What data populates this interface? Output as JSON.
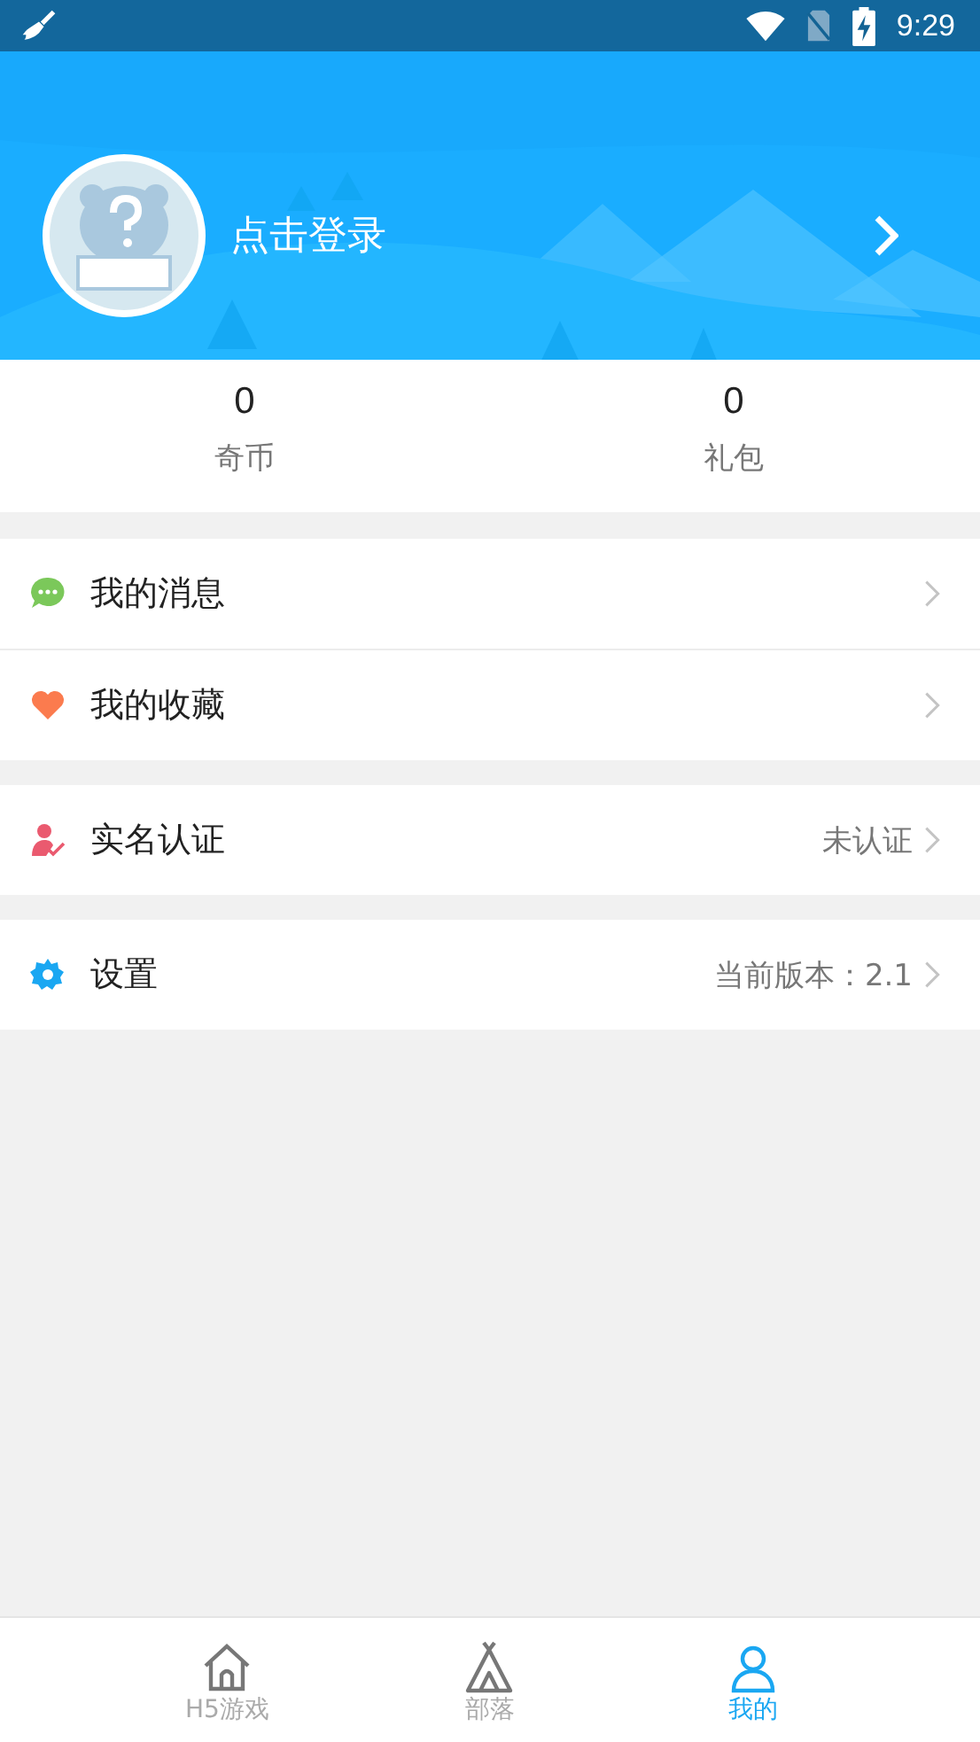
{
  "status_bar": {
    "time": "9:29"
  },
  "profile": {
    "login_label": "点击登录"
  },
  "stats": [
    {
      "value": "0",
      "label": "奇币"
    },
    {
      "value": "0",
      "label": "礼包"
    }
  ],
  "menu_groups": [
    {
      "items": [
        {
          "kind": "message",
          "label": "我的消息"
        },
        {
          "kind": "favorite",
          "label": "我的收藏"
        }
      ]
    },
    {
      "items": [
        {
          "kind": "verify",
          "label": "实名认证",
          "value": "未认证"
        }
      ]
    },
    {
      "items": [
        {
          "kind": "settings",
          "label": "设置",
          "value": "当前版本：2.1"
        }
      ]
    }
  ],
  "tabs": [
    {
      "kind": "home",
      "label": "H5游戏",
      "selected": false
    },
    {
      "kind": "tribe",
      "label": "部落",
      "selected": false
    },
    {
      "kind": "me",
      "label": "我的",
      "selected": true
    }
  ]
}
